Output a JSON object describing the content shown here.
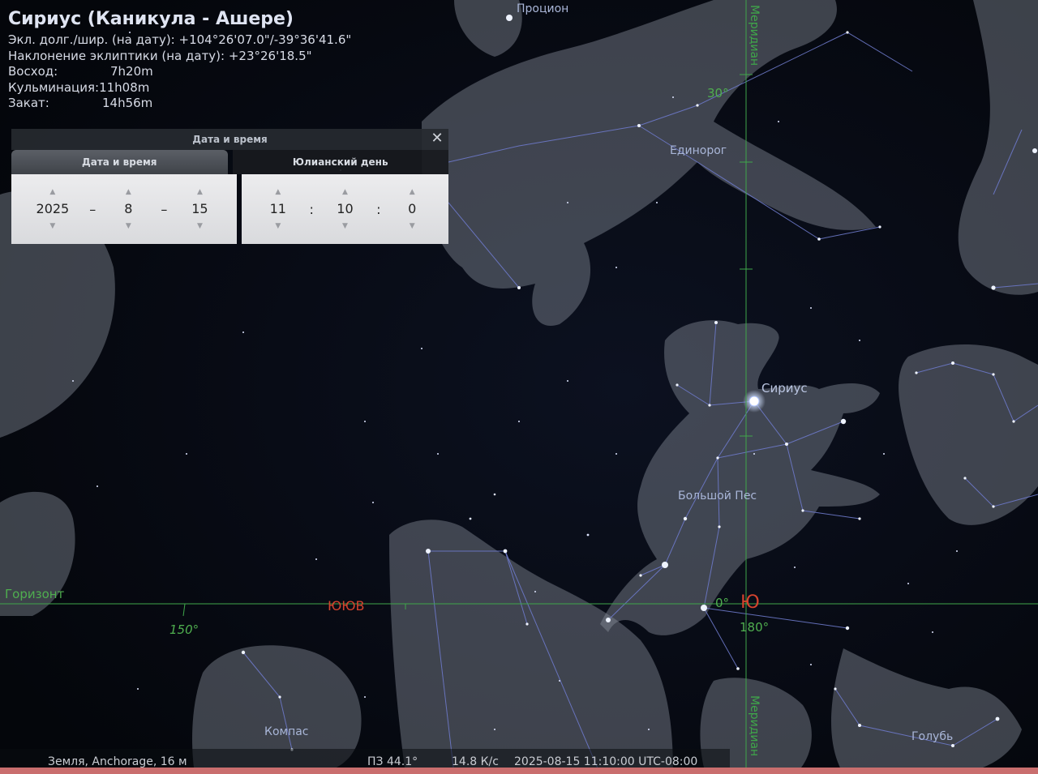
{
  "object_info": {
    "title": "Сириус (Каникула - Ашере)",
    "ecl_coords": "Экл. долг./шир. (на дату): +104°26'07.0\"/-39°36'41.6\"",
    "obliquity": "Наклонение эклиптики (на дату): +23°26'18.5\"",
    "rise_label": "Восход:",
    "rise_value": "7h20m",
    "culmination_label": "Кульминация:",
    "culmination_value": "11h08m",
    "set_label": "Закат:",
    "set_value": "14h56m"
  },
  "datetime_dialog": {
    "title": "Дата и время",
    "tabs": [
      "Дата и время",
      "Юлианский день"
    ],
    "active_tab": 0,
    "year": "2025",
    "month": "8",
    "day": "15",
    "hour": "11",
    "minute": "10",
    "second": "0",
    "date_sep": "–",
    "time_sep": ":",
    "close_symbol": "✕"
  },
  "sky_labels": {
    "procyon": "Процион",
    "monoceros": "Единорог",
    "sirius": "Сириус",
    "canis_major": "Большой Пес",
    "compass": "Компас",
    "columba": "Голубь",
    "horizon": "Горизонт",
    "meridian": "Меридиан",
    "direction_ssw": "ЮЮВ",
    "direction_s": "Ю",
    "alt_30": "30°",
    "alt_0": "0°",
    "az_150": "150°",
    "az_180": "180°"
  },
  "status_bar": {
    "location": "Земля, Anchorage, 16 м",
    "fov": "ПЗ 44.1°",
    "fps": "14.8 К/с",
    "datetime": "2025-08-15 11:10:00 UTC-08:00"
  },
  "colors": {
    "sky": "#05070c",
    "grid_green": "#3fa64a",
    "cardinal_red": "#d5432e",
    "constellation_line": "#6d79c9"
  }
}
